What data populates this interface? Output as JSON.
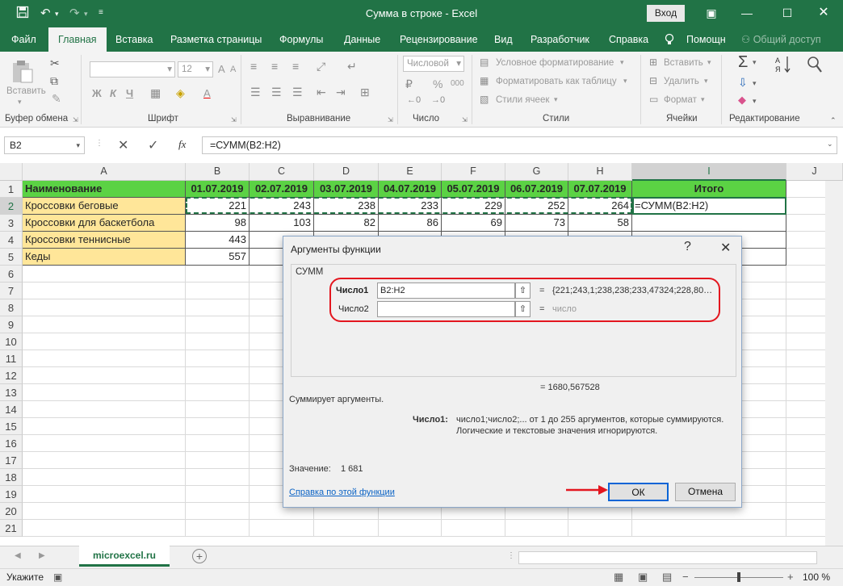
{
  "window": {
    "title": "Сумма в строке  -  Excel",
    "login": "Вход"
  },
  "tabs": [
    "Файл",
    "Главная",
    "Вставка",
    "Разметка страницы",
    "Формулы",
    "Данные",
    "Рецензирование",
    "Вид",
    "Разработчик",
    "Справка",
    "Помощн",
    "Общий доступ"
  ],
  "ribbon": {
    "paste_label": "Вставить",
    "font_size": "12",
    "bold": "Ж",
    "italic": "К",
    "underline": "Ч",
    "number_format": "Числовой",
    "percent": "%",
    "thousands": "000",
    "cond_format": "Условное форматирование",
    "format_table": "Форматировать как таблицу",
    "cell_styles": "Стили ячеек",
    "insert": "Вставить",
    "delete": "Удалить",
    "format": "Формат",
    "groups": [
      "Буфер обмена",
      "Шрифт",
      "Выравнивание",
      "Число",
      "Стили",
      "Ячейки",
      "Редактирование"
    ]
  },
  "formula_bar": {
    "name_box": "B2",
    "fx": "fx",
    "formula": "=СУММ(B2:H2)"
  },
  "columns": [
    "A",
    "B",
    "C",
    "D",
    "E",
    "F",
    "G",
    "H",
    "I",
    "J"
  ],
  "rows": [
    "1",
    "2",
    "3",
    "4",
    "5",
    "6",
    "7",
    "8",
    "9",
    "10",
    "11",
    "12",
    "13",
    "14",
    "15",
    "16",
    "17",
    "18",
    "19",
    "20",
    "21"
  ],
  "table": {
    "header": [
      "Наименование",
      "01.07.2019",
      "02.07.2019",
      "03.07.2019",
      "04.07.2019",
      "05.07.2019",
      "06.07.2019",
      "07.07.2019",
      "Итого"
    ],
    "rows": [
      {
        "name": "Кроссовки беговые",
        "values": [
          "221",
          "243",
          "238",
          "233",
          "229",
          "252",
          "264"
        ],
        "total": "=СУММ(B2:H2)"
      },
      {
        "name": "Кроссовки для баскетбола",
        "values": [
          "98",
          "103",
          "82",
          "86",
          "69",
          "73",
          "58"
        ],
        "total": ""
      },
      {
        "name": "Кроссовки теннисные",
        "values": [
          "443",
          "",
          "",
          "",
          "",
          "",
          ""
        ],
        "total": ""
      },
      {
        "name": "Кеды",
        "values": [
          "557",
          "",
          "",
          "",
          "",
          "",
          ""
        ],
        "total": ""
      }
    ]
  },
  "dialog": {
    "title": "Аргументы функции",
    "help_glyph": "?",
    "close_glyph": "✕",
    "function_name": "СУММ",
    "arg1_label": "Число1",
    "arg1_value": "B2:H2",
    "arg1_result": "{221;243,1;238,238;233,47324;228,80…",
    "arg2_label": "Число2",
    "arg2_value": "",
    "arg2_result": "число",
    "result_line": "=  1680,567528",
    "description": "Суммирует аргументы.",
    "arg_desc_label": "Число1:",
    "arg_desc_line1": "число1;число2;... от 1 до 255 аргументов, которые суммируются.",
    "arg_desc_line2": "Логические и текстовые значения игнорируются.",
    "value_label": "Значение:",
    "value": "1 681",
    "help_link": "Справка по этой функции",
    "ok": "ОК",
    "cancel": "Отмена"
  },
  "sheet": {
    "tab": "microexcel.ru"
  },
  "status": {
    "mode": "Укажите",
    "zoom": "100 %"
  },
  "colors": {
    "excel_green": "#217346",
    "header_fill": "#5bd244",
    "name_fill": "#ffe699",
    "annotation_red": "#e3161f"
  }
}
